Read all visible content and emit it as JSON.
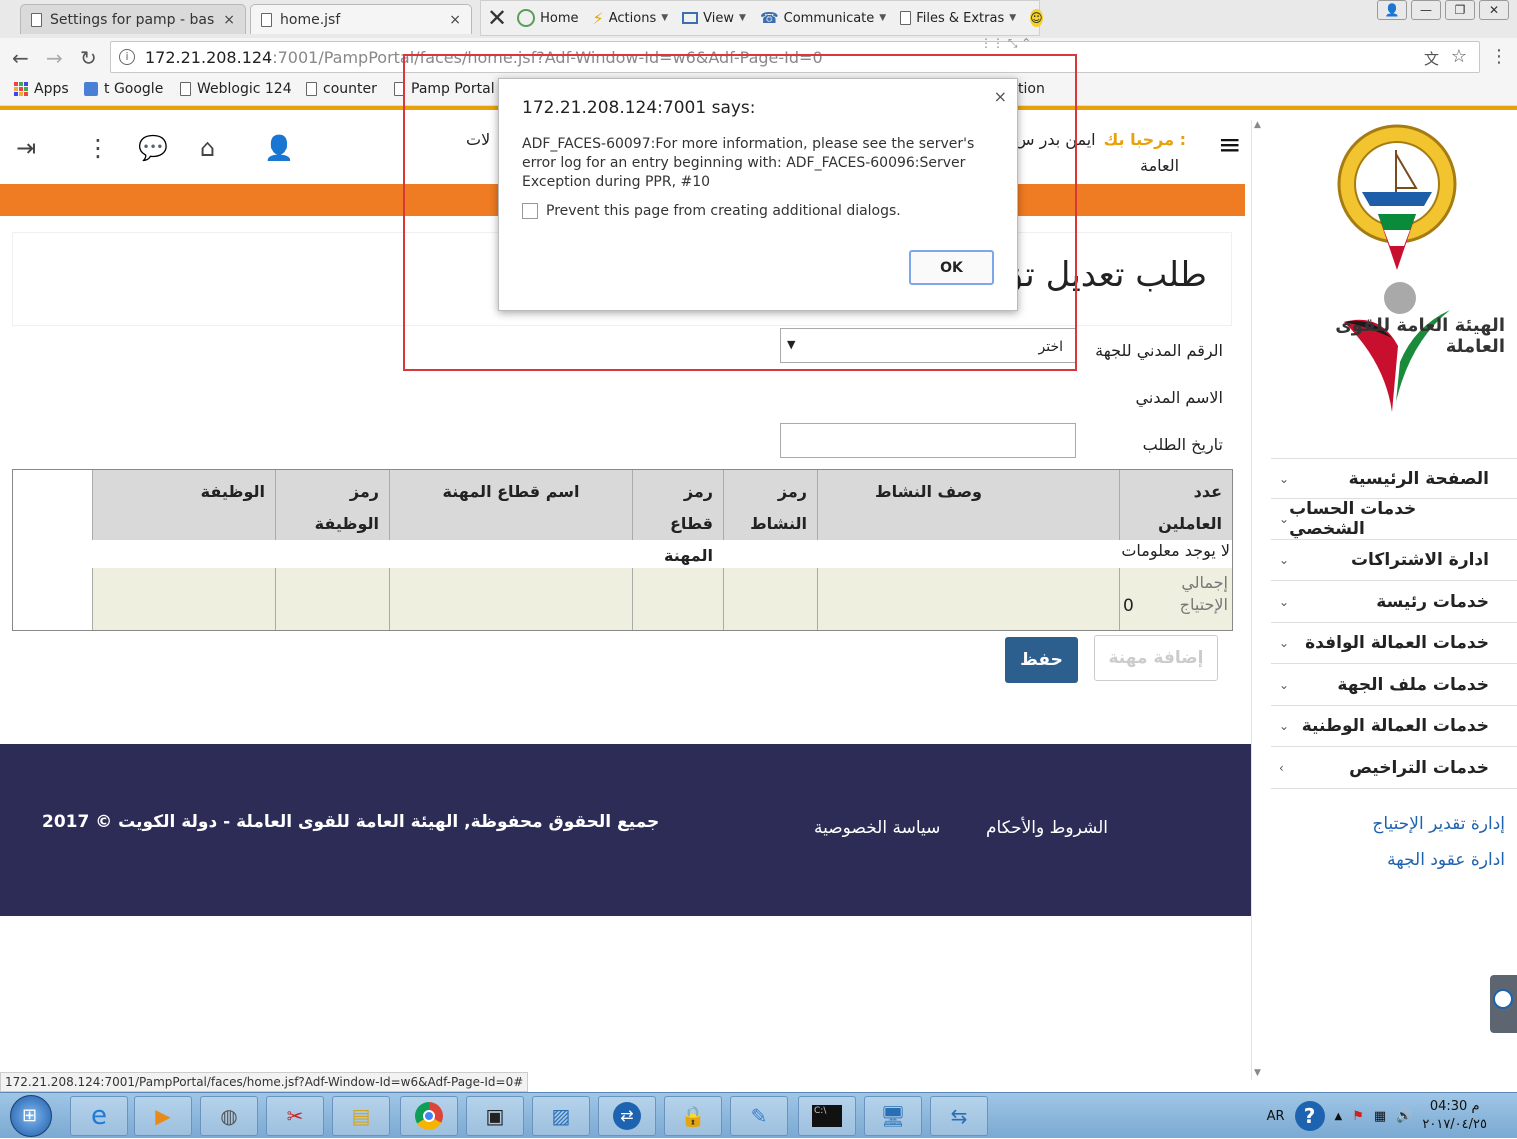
{
  "browser": {
    "tabs": [
      {
        "title": "Settings for pamp - base",
        "close": "×"
      },
      {
        "title": "home.jsf",
        "close": "×"
      }
    ],
    "url_host": "172.21.208.124",
    "url_path": ":7001/PampPortal/faces/home.jsf?Adf-Window-Id=w6&Adf-Page-Id=0",
    "bookmarks": [
      "Apps",
      "t Google",
      "Weblogic 124",
      "counter",
      "Pamp Portal",
      "tion"
    ],
    "window_controls": [
      "👤",
      "—",
      "❐",
      "✕"
    ]
  },
  "teamviewer": {
    "items": [
      "Home",
      "Actions",
      "View",
      "Communicate",
      "Files & Extras"
    ]
  },
  "header": {
    "welcome_label": "مرحبا بك :",
    "user_name": "ايمن بدر س",
    "user_trail": "لات",
    "user_line2": "العامة"
  },
  "sidebar": {
    "org_name": "الهيئة العامة للقوى العاملة",
    "menu": [
      {
        "label": "الصفحة الرئيسية",
        "chev": "⌄"
      },
      {
        "label": "خدمات الحساب الشخصي",
        "chev": "⌄"
      },
      {
        "label": "ادارة الاشتراكات",
        "chev": "⌄"
      },
      {
        "label": "خدمات رئيسة",
        "chev": "⌄"
      },
      {
        "label": "خدمات العمالة الوافدة",
        "chev": "⌄"
      },
      {
        "label": "خدمات ملف الجهة",
        "chev": "⌄"
      },
      {
        "label": "خدمات العمالة الوطنية",
        "chev": "⌄"
      },
      {
        "label": "خدمات التراخيص",
        "chev": "‹"
      }
    ],
    "links": [
      "إدارة تقدير الإحتياج",
      "ادارة عقود الجهة"
    ]
  },
  "form": {
    "title": "طلب تعديل تق",
    "civil_id_label": "الرقم المدني للجهة",
    "civil_id_select_value": "اختر",
    "civil_name_label": "الاسم المدني",
    "request_date_label": "تاريخ الطلب"
  },
  "table": {
    "headers": [
      "عدد العاملين",
      "وصف النشاط",
      "رمز النشاط",
      "رمز قطاع المهنة",
      "اسم قطاع المهنة",
      "رمز الوظيفة",
      "الوظيفة"
    ],
    "no_data": "لا يوجد معلومات",
    "total_label": "إجمالي الإحتياج",
    "total_value": "0"
  },
  "buttons": {
    "save": "حفظ",
    "add_profession": "إضافة مهنة"
  },
  "footer": {
    "copyright": "جميع الحقوق محفوظة, الهيئة العامة للقوى العاملة - دولة الكويت © 2017",
    "privacy": "سياسة الخصوصية",
    "terms": "الشروط والأحكام"
  },
  "dialog": {
    "title": "172.21.208.124:7001 says:",
    "message": "ADF_FACES-60097:For more information, please see the server's error log for an entry beginning with: ADF_FACES-60096:Server Exception during PPR, #10",
    "checkbox_label": "Prevent this page from creating additional dialogs.",
    "ok_label": "OK",
    "close": "×"
  },
  "status_url": "172.21.208.124:7001/PampPortal/faces/home.jsf?Adf-Window-Id=w6&Adf-Page-Id=0#",
  "taskbar": {
    "lang": "AR",
    "time": "04:30 م",
    "date": "٢٠١٧/٠٤/٢٥"
  },
  "colors": {
    "orange_bar": "#ef7b22",
    "footer_bg": "#2d2c57",
    "primary_button": "#2c5f8e",
    "link": "#1e63b0",
    "highlight_box": "#d9373a"
  }
}
